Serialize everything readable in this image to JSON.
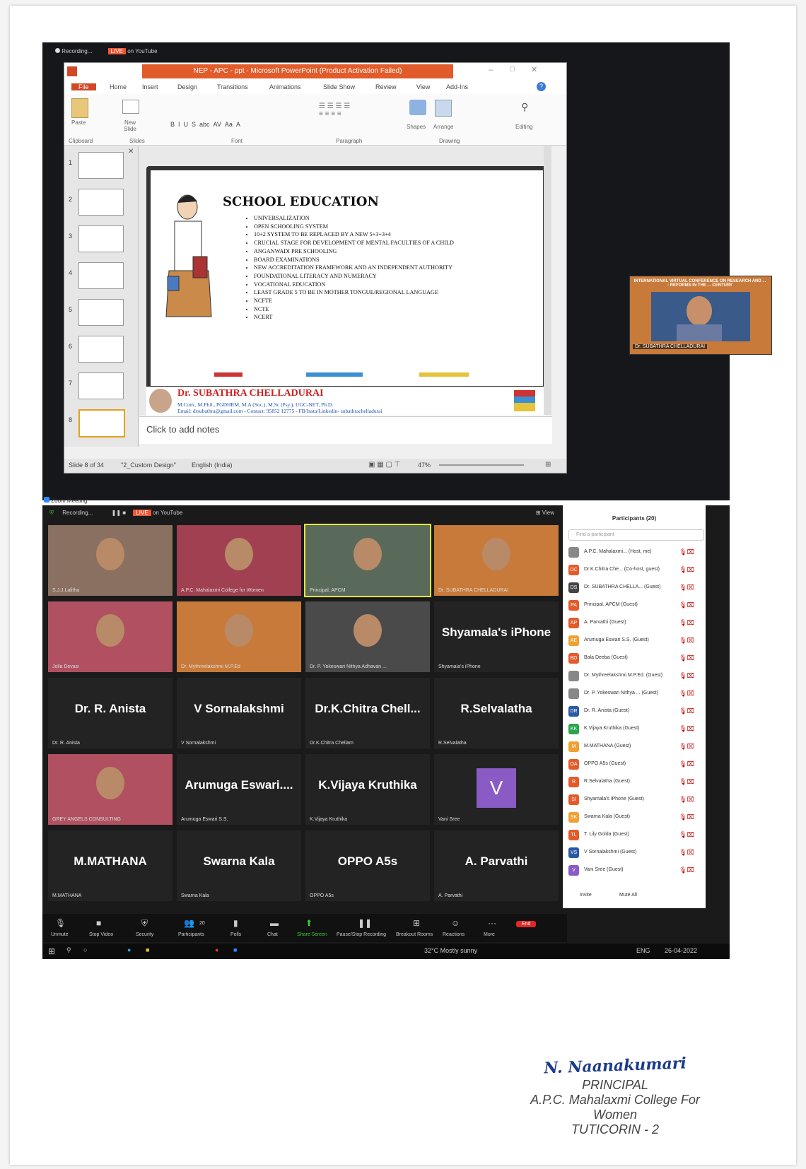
{
  "ppt": {
    "rec_label": "Recording...",
    "live_badge": "LIVE",
    "live_target": "on YouTube",
    "title": "NEP - APC - ppt - Microsoft PowerPoint (Product Activation Failed)",
    "tabs": [
      "File",
      "Home",
      "Insert",
      "Design",
      "Transitions",
      "Animations",
      "Slide Show",
      "Review",
      "View",
      "Add-Ins"
    ],
    "groups": {
      "clipboard": "Clipboard",
      "slides": "Slides",
      "font": "Font",
      "paragraph": "Paragraph",
      "drawing": "Drawing",
      "editing": "Editing",
      "paste": "Paste",
      "new_slide": "New Slide",
      "shapes": "Shapes",
      "arrange": "Arrange"
    },
    "slide_numbers": [
      "1",
      "2",
      "3",
      "4",
      "5",
      "6",
      "7",
      "8"
    ],
    "slide": {
      "title": "SCHOOL EDUCATION",
      "bullets": [
        "UNIVERSALIZATION",
        "OPEN SCHOOLING SYSTEM",
        "10+2 SYSTEM TO BE REPLACED BY A NEW 5+3+3+4",
        "CRUCIAL STAGE FOR DEVELOPMENT OF MENTAL FACULTIES OF A CHILD",
        "ANGANWADI PRE SCHOOLING",
        "BOARD EXAMINATIONS",
        "NEW ACCREDITATION FRAMEWORK AND AN INDEPENDENT AUTHORITY",
        "FOUNDATIONAL LITERACY AND NUMERACY",
        "VOCATIONAL EDUCATION",
        "LEAST GRADE 5 TO BE IN MOTHER TONGUE/REGIONAL LANGUAGE",
        "NCFTE",
        "NCTE",
        "NCERT"
      ],
      "footer_name": "Dr. SUBATHRA CHELLADURAI",
      "footer_line1": "M.Com., M.Phil., PGDHRM, M.A (Soc.), M.Sc (Psy.), UGC-NET, Ph.D.",
      "footer_line2": "Email: drsubathra@gmail.com - Contact: 95852 12775 - FB/Insta/Linkedin- subathrachelladurai"
    },
    "notes_placeholder": "Click to add notes",
    "status": {
      "slide": "Slide 8 of 34",
      "theme": "\"2_Custom Design\"",
      "language": "English (India)",
      "zoom": "47%"
    }
  },
  "presenter": {
    "banner": "INTERNATIONAL VIRTUAL CONFERENCE ON RESEARCH AND ... : REFORMS IN THE ... CENTURY",
    "name": "Dr. SUBATHRA CHELLADURAI"
  },
  "zoom": {
    "window_title": "Zoom Meeting",
    "rec_label": "Recording...",
    "live_badge": "LIVE",
    "live_target": "on YouTube",
    "view_label": "View",
    "tiles": [
      {
        "name": "",
        "label": "S.J.J.Lalitha",
        "video": true
      },
      {
        "name": "",
        "label": "A.P.C. Mahalaxmi College for Women",
        "video": true
      },
      {
        "name": "",
        "label": "Principal, APCM",
        "video": true
      },
      {
        "name": "",
        "label": "Dr. SUBATHRA CHELLADURAI",
        "video": true
      },
      {
        "name": "",
        "label": "Jolla Devasi",
        "video": true
      },
      {
        "name": "",
        "label": "Dr. Mythreelakshmi M.P.Ed",
        "video": true
      },
      {
        "name": "",
        "label": "Dr. P. Yokeswari Nithya Adhavan ...",
        "video": true
      },
      {
        "name": "Shyamala's iPhone",
        "label": "Shyamala's iPhone",
        "video": false
      },
      {
        "name": "Dr. R. Anista",
        "label": "Dr. R. Anista",
        "video": false
      },
      {
        "name": "V Sornalakshmi",
        "label": "V Sornalakshmi",
        "video": false
      },
      {
        "name": "Dr.K.Chitra  Chell...",
        "label": "Dr.K.Chitra Chellam",
        "video": false
      },
      {
        "name": "R.Selvalatha",
        "label": "R.Selvalatha",
        "video": false
      },
      {
        "name": "",
        "label": "GREY ANGELS CONSULTING",
        "video": true
      },
      {
        "name": "Arumuga  Eswari....",
        "label": "Arumuga Eswari S.S.",
        "video": false
      },
      {
        "name": "K.Vijaya Kruthika",
        "label": "K.Vijaya Kruthika",
        "video": false
      },
      {
        "name": "V",
        "label": "Vani Sree",
        "video": false
      },
      {
        "name": "M.MATHANA",
        "label": "M.MATHANA",
        "video": false
      },
      {
        "name": "Swarna Kala",
        "label": "Swarna Kala",
        "video": false
      },
      {
        "name": "OPPO A5s",
        "label": "OPPO A5s",
        "video": false
      },
      {
        "name": "A. Parvathi",
        "label": "A. Parvathi",
        "video": false
      }
    ],
    "toolbar": [
      "Unmute",
      "Stop Video",
      "Security",
      "Participants",
      "Polls",
      "Chat",
      "Share Screen",
      "Pause/Stop Recording",
      "Breakout Rooms",
      "Reactions",
      "More",
      "End"
    ],
    "participants_count": "20",
    "participants_title": "Participants (20)",
    "search_placeholder": "Find a participant",
    "participants": [
      {
        "initials": "",
        "name": "A.P.C. Mahalaxmi... (Host, me)",
        "color": "#888888"
      },
      {
        "initials": "DC",
        "name": "Dr.K.Chitra Che... (Co-host, guest)",
        "color": "#e35b2a"
      },
      {
        "initials": "DS",
        "name": "Dr. SUBATHRA CHELLA... (Guest)",
        "color": "#444444"
      },
      {
        "initials": "PA",
        "name": "Principal, APCM (Guest)",
        "color": "#e35b2a"
      },
      {
        "initials": "AP",
        "name": "A. Parvathi (Guest)",
        "color": "#e35b2a"
      },
      {
        "initials": "AE",
        "name": "Arumuga Eswari S.S. (Guest)",
        "color": "#f0a030"
      },
      {
        "initials": "BD",
        "name": "Bala Deeba (Guest)",
        "color": "#e35b2a"
      },
      {
        "initials": "",
        "name": "Dr. Mythreelakshmi M.P.Ed. (Guest)",
        "color": "#888888"
      },
      {
        "initials": "",
        "name": "Dr. P. Yokeswari Nithya ... (Guest)",
        "color": "#888888"
      },
      {
        "initials": "DR",
        "name": "Dr. R. Anista (Guest)",
        "color": "#2a5aa5"
      },
      {
        "initials": "KK",
        "name": "K.Vijaya Kruthika (Guest)",
        "color": "#2aa54a"
      },
      {
        "initials": "M",
        "name": "M.MATHANA (Guest)",
        "color": "#f0a030"
      },
      {
        "initials": "OA",
        "name": "OPPO A5s (Guest)",
        "color": "#e35b2a"
      },
      {
        "initials": "R",
        "name": "R.Selvalatha (Guest)",
        "color": "#e35b2a"
      },
      {
        "initials": "SI",
        "name": "Shyamala's iPhone (Guest)",
        "color": "#e35b2a"
      },
      {
        "initials": "SK",
        "name": "Swarna Kala (Guest)",
        "color": "#f0a030"
      },
      {
        "initials": "TL",
        "name": "T. Lily Golda (Guest)",
        "color": "#e35b2a"
      },
      {
        "initials": "VS",
        "name": "V Sornalakshmi (Guest)",
        "color": "#2a5aa5"
      },
      {
        "initials": "V",
        "name": "Vani Sree (Guest)",
        "color": "#8a5ac5"
      }
    ],
    "invite_label": "Invite",
    "mute_all_label": "Mute All",
    "weather": "32°C  Mostly sunny",
    "tray_lang": "ENG",
    "tray_date": "26-04-2022"
  },
  "signature": {
    "name": "N. Naanakumari",
    "title": "PRINCIPAL",
    "college": "A.P.C. Mahalaxmi College For Women",
    "city": "TUTICORIN - 2"
  }
}
